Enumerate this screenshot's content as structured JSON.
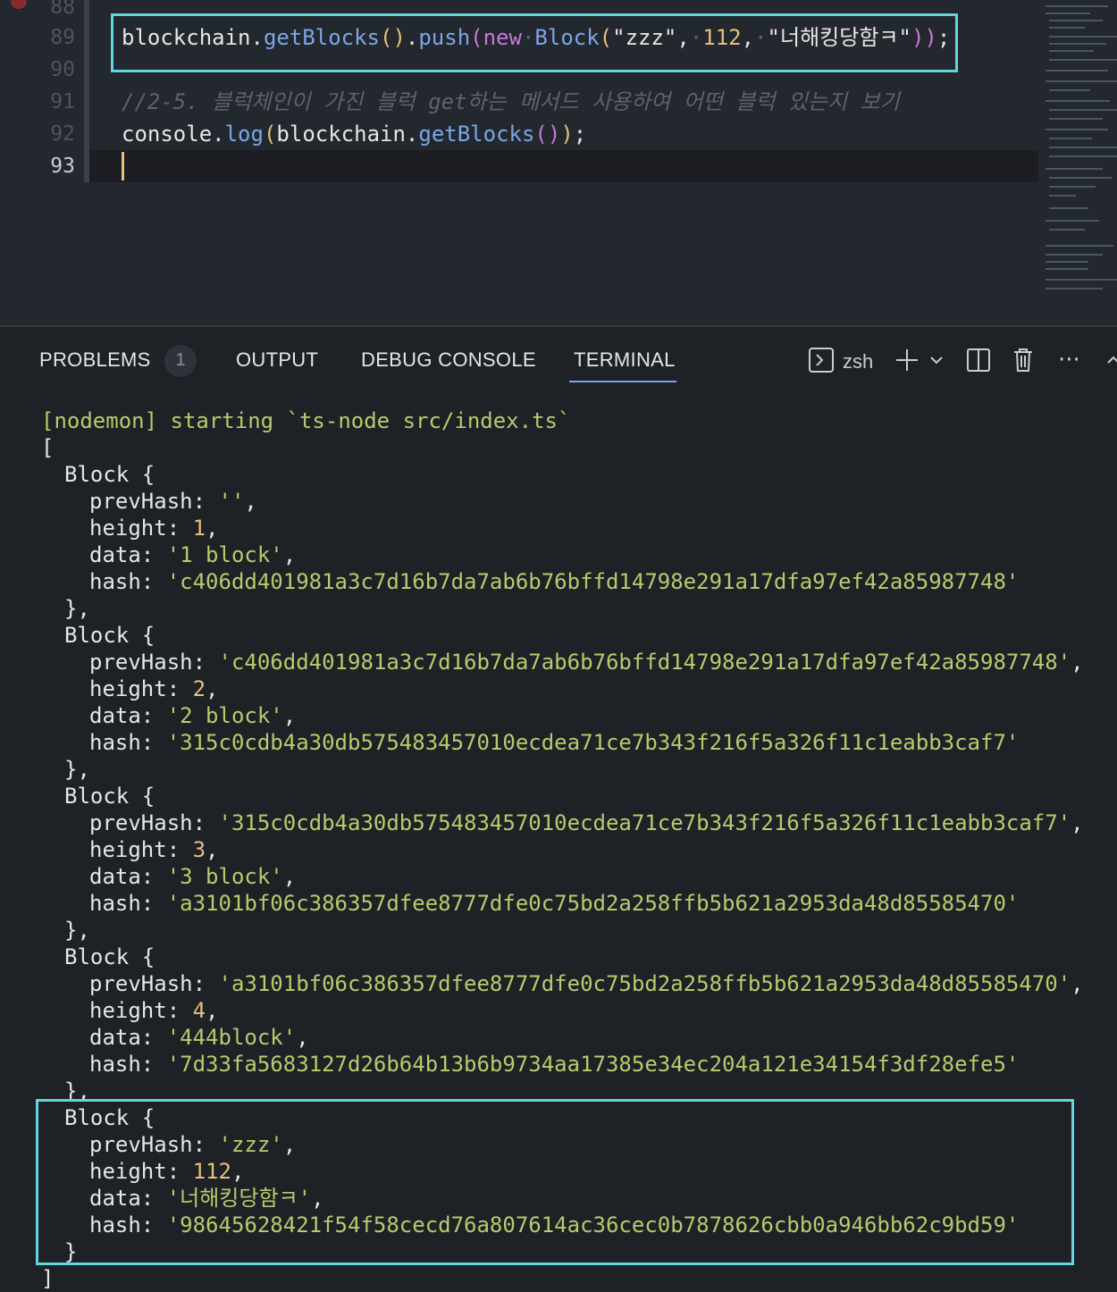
{
  "editor": {
    "line_numbers": [
      "88",
      "89",
      "90",
      "91",
      "92",
      "93"
    ],
    "line89": {
      "obj": "blockchain",
      "dot1": ".",
      "m1": "getBlocks",
      "paren1": "()",
      "dot2": ".",
      "m2": "push",
      "open": "(",
      "kw": "new",
      "cls": "Block",
      "open2": "(",
      "s1": "\"zzz\"",
      "c1": ",",
      "n1": "112",
      "c2": ",",
      "s2": "\"너해킹당함ㅋ\"",
      "close": "))",
      "semi": ";"
    },
    "line91_comment": "//2-5. 블럭체인이 가진 블럭 get하는 메서드 사용하여 어떤 블럭 있는지 보기",
    "line92": {
      "obj": "console",
      "dot": ".",
      "m": "log",
      "open": "(",
      "arg": "blockchain",
      "dot2": ".",
      "m2": "getBlocks",
      "paren": "()",
      "close": ")",
      "semi": ";"
    }
  },
  "panel": {
    "tabs": {
      "problems": "PROBLEMS",
      "problems_count": "1",
      "output": "OUTPUT",
      "debug": "DEBUG CONSOLE",
      "terminal": "TERMINAL"
    },
    "toolbar": {
      "shell_icon": "terminal-icon",
      "shell": "zsh",
      "add": "+",
      "chevron": "⌄",
      "split_icon": "split-icon",
      "trash_icon": "trash-icon",
      "more": "···",
      "maximize": "⌃"
    }
  },
  "terminal": {
    "start_line": "[nodemon] starting `ts-node src/index.ts`",
    "open_bracket": "[",
    "close_bracket": "]",
    "blocks": [
      {
        "header": "Block {",
        "prevHash": "''",
        "height": "1",
        "data": "'1 block'",
        "hash": "'c406dd401981a3c7d16b7da7ab6b76bffd14798e291a17dfa97ef42a85987748'",
        "closer": "},"
      },
      {
        "header": "Block {",
        "prevHash": "'c406dd401981a3c7d16b7da7ab6b76bffd14798e291a17dfa97ef42a85987748'",
        "height": "2",
        "data": "'2 block'",
        "hash": "'315c0cdb4a30db575483457010ecdea71ce7b343f216f5a326f11c1eabb3caf7'",
        "closer": "},"
      },
      {
        "header": "Block {",
        "prevHash": "'315c0cdb4a30db575483457010ecdea71ce7b343f216f5a326f11c1eabb3caf7'",
        "height": "3",
        "data": "'3 block'",
        "hash": "'a3101bf06c386357dfee8777dfe0c75bd2a258ffb5b621a2953da48d85585470'",
        "closer": "},"
      },
      {
        "header": "Block {",
        "prevHash": "'a3101bf06c386357dfee8777dfe0c75bd2a258ffb5b621a2953da48d85585470'",
        "height": "4",
        "data": "'444block'",
        "hash": "'7d33fa5683127d26b64b13b6b9734aa17385e34ec204a121e34154f3df28efe5'",
        "closer": "},"
      },
      {
        "header": "Block {",
        "prevHash": "'zzz'",
        "height": "112",
        "data": "'너해킹당함ㅋ'",
        "hash": "'98645628421f54f58cecd76a807614ac36cec0b7878626cbb0a946bb62c9bd59'",
        "closer": "}"
      }
    ],
    "labels": {
      "prevHash": "prevHash: ",
      "height": "height: ",
      "data": "data: ",
      "hash": "hash: "
    }
  },
  "colors": {
    "highlight_box": "#5fd6e0",
    "accent": "#7aa7e8",
    "string": "#b5cc6d",
    "number": "#e5c07b"
  }
}
